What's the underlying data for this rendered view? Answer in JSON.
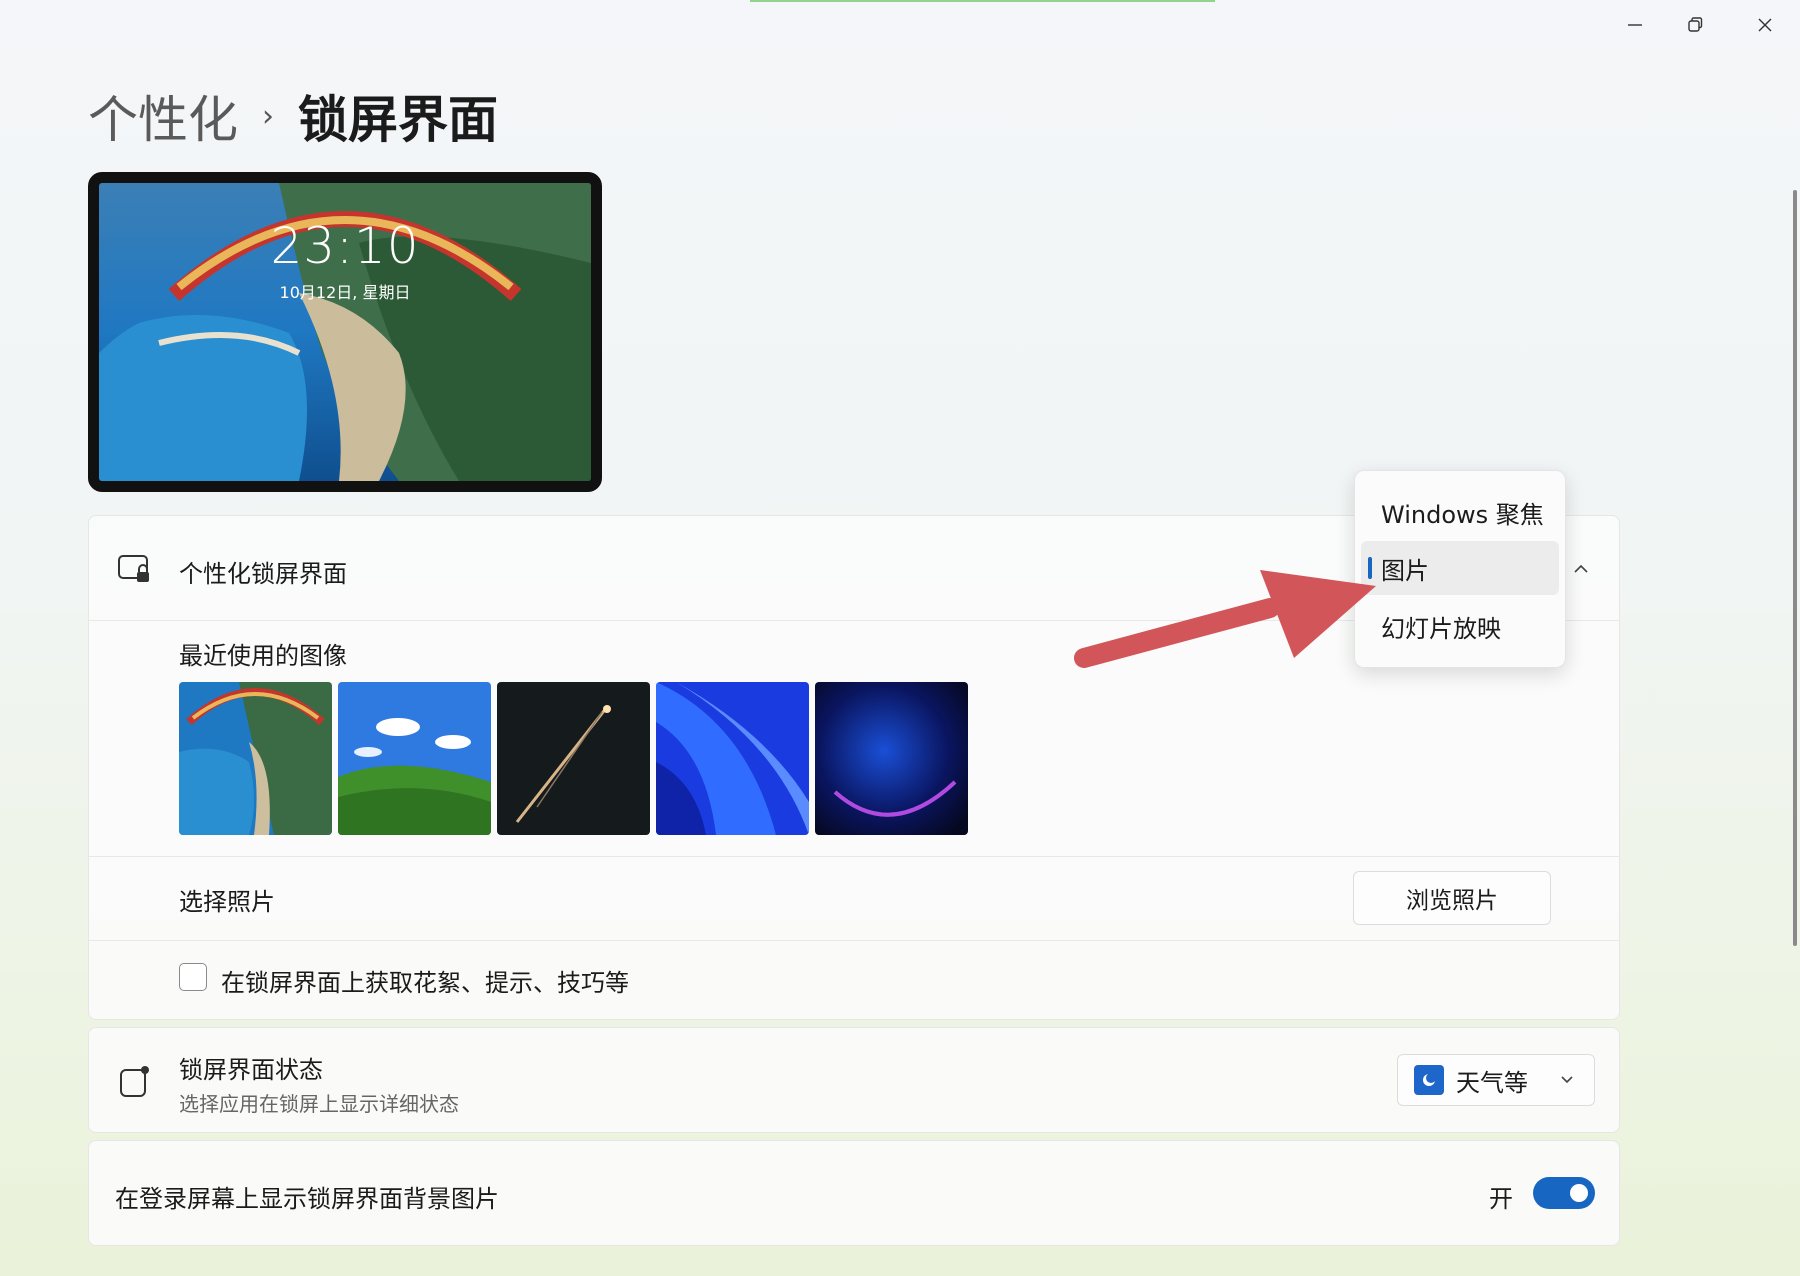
{
  "window": {
    "minimize_icon": "minimize-icon",
    "restore_icon": "restore-icon",
    "close_icon": "close-icon"
  },
  "breadcrumb": {
    "parent": "个性化",
    "separator": "›",
    "current": "锁屏界面"
  },
  "preview": {
    "time": "23:10",
    "date": "10月12日, 星期日"
  },
  "personalize": {
    "title": "个性化锁屏界面",
    "icon": "lockscreen-icon",
    "recent_label": "最近使用的图像",
    "thumbnails": [
      "paraglider-beach",
      "bliss-hills",
      "shooting-star",
      "win11-bloom-blue",
      "win11-bloom-dark"
    ],
    "choose_label": "选择照片",
    "browse_button": "浏览照片",
    "tips_checkbox_label": "在锁屏界面上获取花絮、提示、技巧等",
    "tips_checked": false
  },
  "dropdown_menu": {
    "items": [
      "Windows 聚焦",
      "图片",
      "幻灯片放映"
    ],
    "selected": "图片"
  },
  "status": {
    "title": "锁屏界面状态",
    "subtitle": "选择应用在锁屏上显示详细状态",
    "dropdown_value": "天气等",
    "icon": "lockscreen-status-icon"
  },
  "login": {
    "title": "在登录屏幕上显示锁屏界面背景图片",
    "toggle_state": "开",
    "toggle_on": true
  },
  "colors": {
    "accent": "#1767c2",
    "annotation_arrow": "#d2555a"
  }
}
